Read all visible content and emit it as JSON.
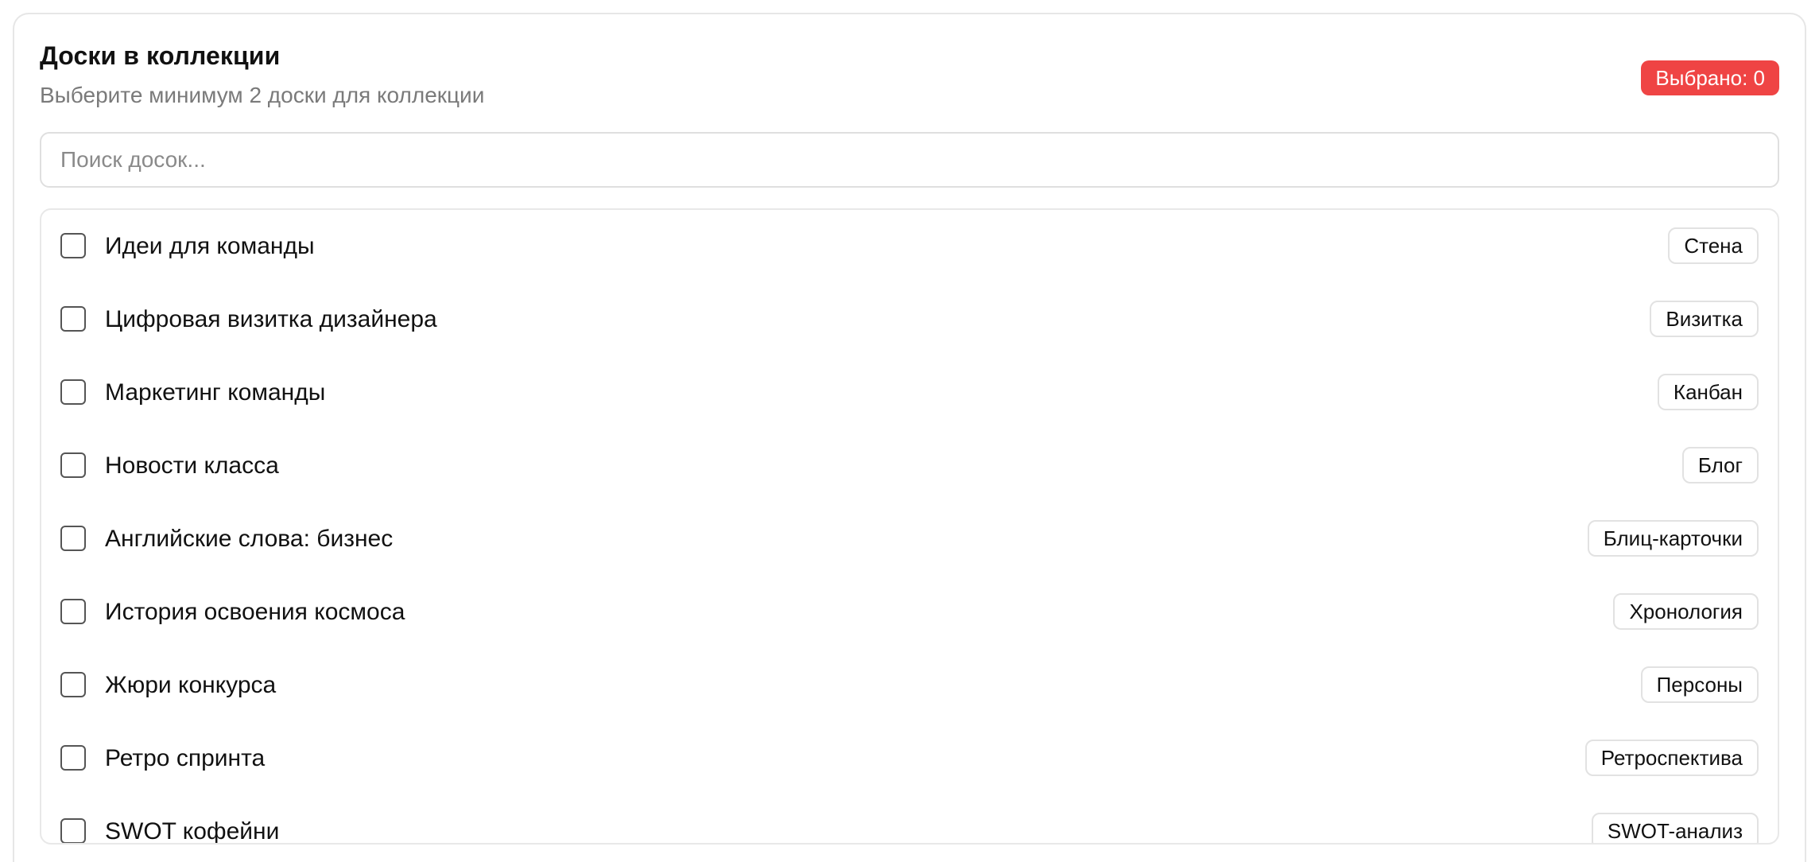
{
  "header": {
    "title": "Доски в коллекции",
    "subtitle": "Выберите минимум 2 доски для коллекции",
    "selected_badge": "Выбрано: 0"
  },
  "search": {
    "placeholder": "Поиск досок..."
  },
  "boards": [
    {
      "name": "Идеи для команды",
      "type": "Стена",
      "checked": false
    },
    {
      "name": "Цифровая визитка дизайнера",
      "type": "Визитка",
      "checked": false
    },
    {
      "name": "Маркетинг команды",
      "type": "Канбан",
      "checked": false
    },
    {
      "name": "Новости класса",
      "type": "Блог",
      "checked": false
    },
    {
      "name": "Английские слова: бизнес",
      "type": "Блиц-карточки",
      "checked": false
    },
    {
      "name": "История освоения космоса",
      "type": "Хронология",
      "checked": false
    },
    {
      "name": "Жюри конкурса",
      "type": "Персоны",
      "checked": false
    },
    {
      "name": "Ретро спринта",
      "type": "Ретроспектива",
      "checked": false
    },
    {
      "name": "SWOT кофейни",
      "type": "SWOT-анализ",
      "checked": false
    }
  ],
  "colors": {
    "badge_bg": "#ef4444",
    "border": "#e6e6e6",
    "muted_text": "#7a7a7a"
  }
}
